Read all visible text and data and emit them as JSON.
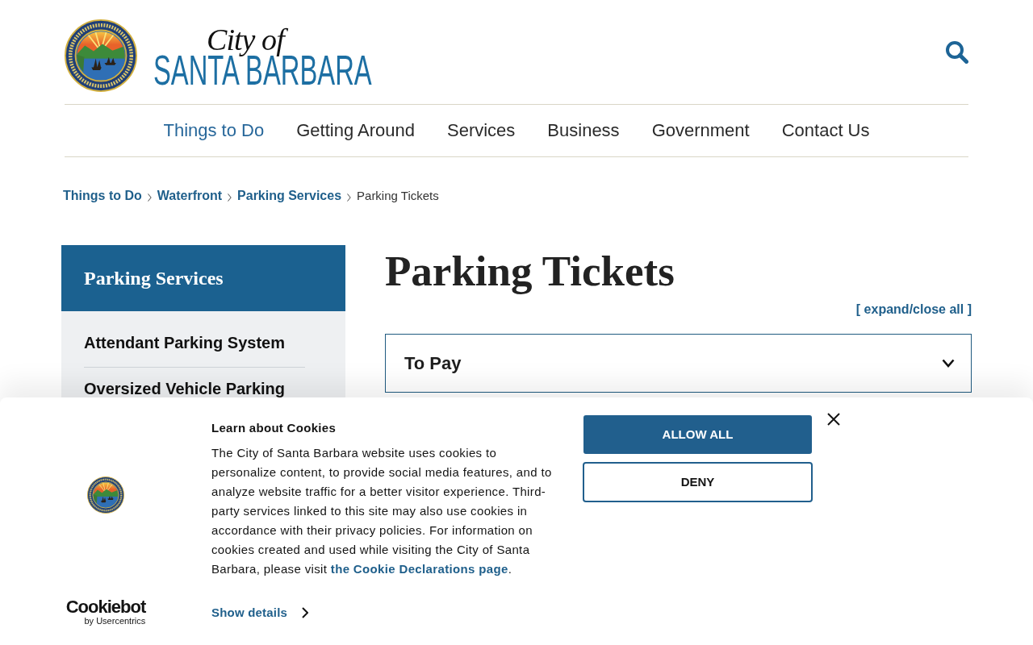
{
  "header": {
    "logo": {
      "script": "City of",
      "name": "SANTA BARBARA"
    }
  },
  "nav": [
    {
      "label": "Things to Do",
      "selected": true
    },
    {
      "label": "Getting Around",
      "selected": false
    },
    {
      "label": "Services",
      "selected": false
    },
    {
      "label": "Business",
      "selected": false
    },
    {
      "label": "Government",
      "selected": false
    },
    {
      "label": "Contact Us",
      "selected": false
    }
  ],
  "breadcrumb": [
    {
      "label": "Things to Do",
      "kind": "link"
    },
    {
      "label": "Waterfront",
      "kind": "link"
    },
    {
      "label": "Parking Services",
      "kind": "link"
    },
    {
      "label": "Parking Tickets",
      "kind": "current"
    }
  ],
  "sidebar": {
    "title": "Parking Services",
    "items": [
      {
        "label": "Attendant Parking System"
      },
      {
        "label": "Oversized Vehicle Parking"
      }
    ]
  },
  "content": {
    "title": "Parking Tickets",
    "expand_all_link": "[ expand/close all ]",
    "accordion": [
      {
        "label": "To Pay",
        "expanded": false
      }
    ]
  },
  "cookie_banner": {
    "branding": {
      "name": "Cookiebot",
      "tagline": "by Usercentrics"
    },
    "title": "Learn about Cookies",
    "body": {
      "text": "The City of Santa Barbara website uses cookies to personalize content, to provide social media features, and to analyze website traffic for a better visitor experience. Third-party services linked to this site may also use cookies in accordance with their privacy policies. For information on cookies created and used while visiting the City of Santa Barbara, please visit ",
      "link": "the Cookie Declarations page",
      "text_end": "."
    },
    "show_details": "Show details",
    "buttons": [
      {
        "label": "ALLOW ALL",
        "kind": "primary"
      },
      {
        "label": "DENY",
        "kind": "secondary"
      }
    ]
  }
}
